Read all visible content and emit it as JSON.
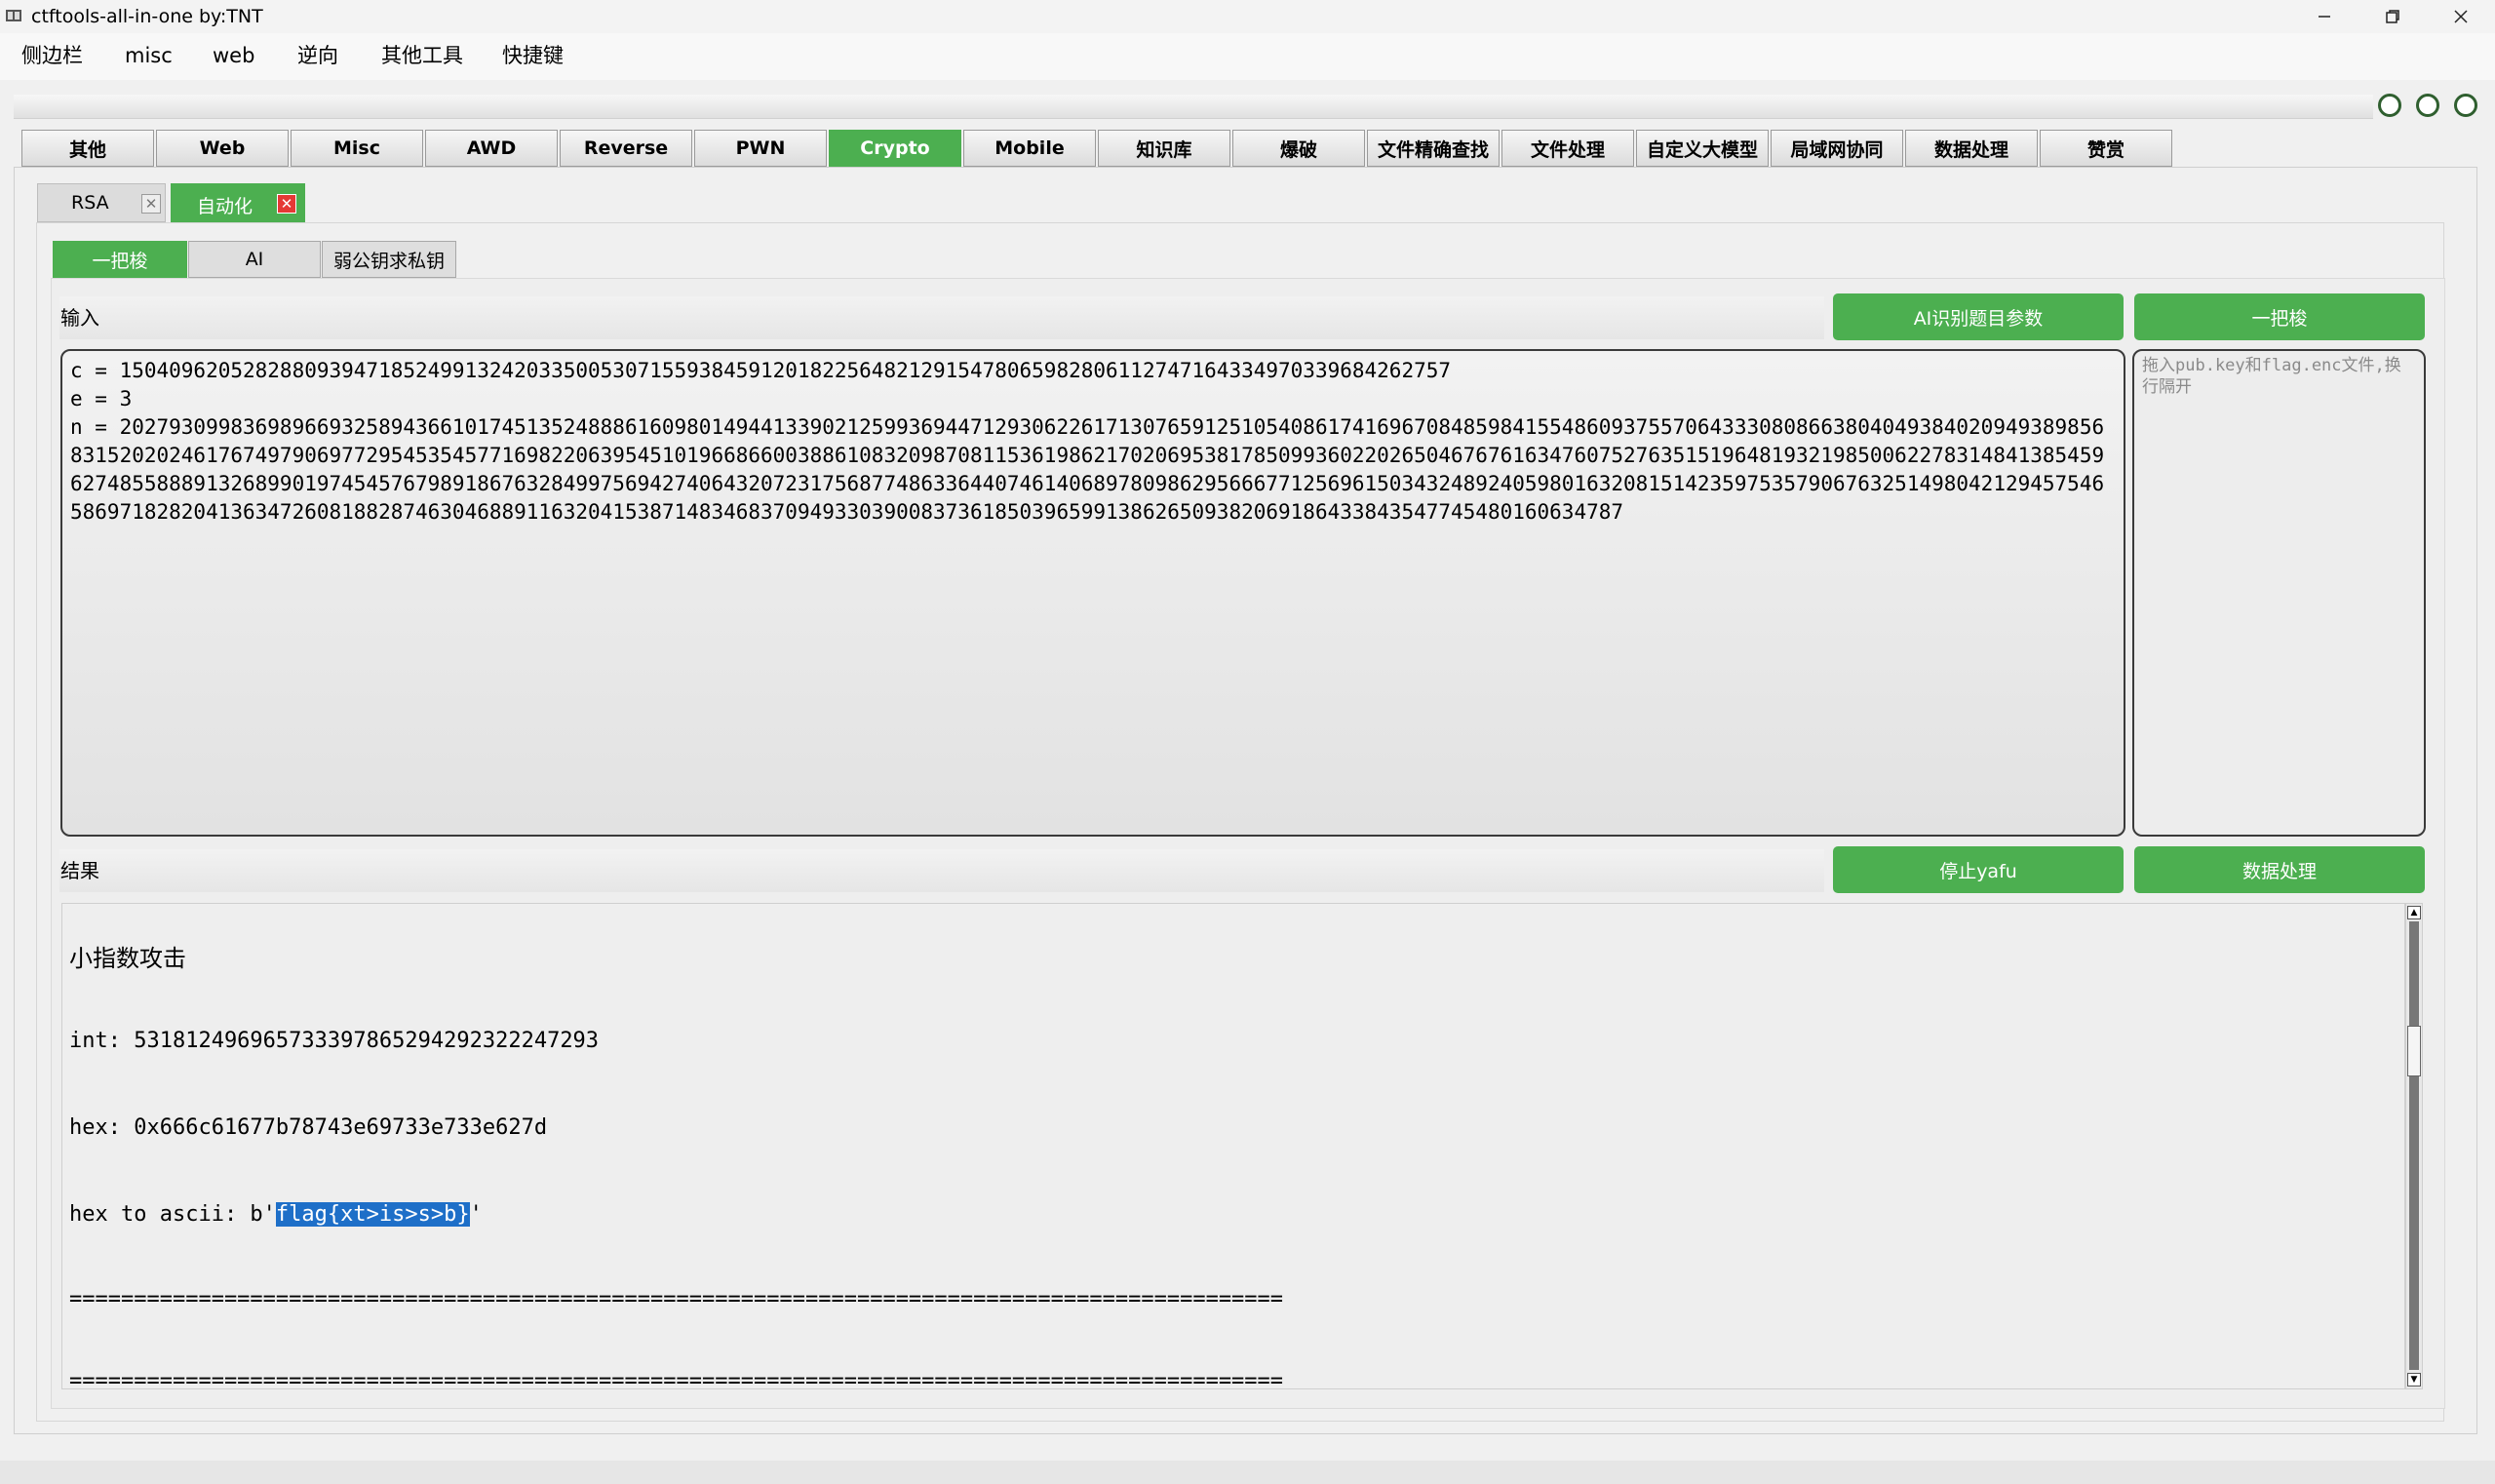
{
  "window": {
    "title": "ctftools-all-in-one   by:TNT"
  },
  "menu": [
    "侧边栏",
    "misc",
    "web",
    "逆向",
    "其他工具",
    "快捷键"
  ],
  "main_tabs": [
    {
      "label": "其他",
      "active": false
    },
    {
      "label": "Web",
      "active": false
    },
    {
      "label": "Misc",
      "active": false
    },
    {
      "label": "AWD",
      "active": false
    },
    {
      "label": "Reverse",
      "active": false
    },
    {
      "label": "PWN",
      "active": false
    },
    {
      "label": "Crypto",
      "active": true
    },
    {
      "label": "Mobile",
      "active": false
    },
    {
      "label": "知识库",
      "active": false
    },
    {
      "label": "爆破",
      "active": false
    },
    {
      "label": "文件精确查找",
      "active": false
    },
    {
      "label": "文件处理",
      "active": false
    },
    {
      "label": "自定义大模型",
      "active": false
    },
    {
      "label": "局域网协同",
      "active": false
    },
    {
      "label": "数据处理",
      "active": false
    },
    {
      "label": "赞赏",
      "active": false
    }
  ],
  "open_tabs": [
    {
      "label": "RSA",
      "active": false
    },
    {
      "label": "自动化",
      "active": true
    }
  ],
  "sub_tabs": [
    {
      "label": "一把梭",
      "active": true
    },
    {
      "label": "AI",
      "active": false
    },
    {
      "label": "弱公钥求私钥",
      "active": false
    }
  ],
  "input_section": {
    "label": "输入",
    "ai_button": "AI识别题目参数",
    "run_button": "一把梭",
    "text": "c = 15040962052828809394718524991324203350053071559384591201822564821291547806598280611274716433497033968426275​7\ne = 3\nn = 20279309983698966932589436610174513524888616098014944133902125993694471293062261713076591251054086174169670848598415548609375570643330808663804049384020949389856831520202461767497906977295453545771698220639545101966866003886108320987081153619862170206953817850993602202650467676163476075276351519648193219850062278314841385459627485588891326899019745457679891867632849975694274064320723175687748633644074614068978098629566677125696150343248924059801632081514235975357906763251498042129457546586971828204136347260818828746304688911632041538714834683709493303900837361850396599138626509382069186433843547745480160634787",
    "side_placeholder": "拖入pub.key和flag.enc文件,换行隔开"
  },
  "result_section": {
    "label": "结果",
    "stop_button": "停止yafu",
    "process_button": "数据处理",
    "heading": "小指数攻击",
    "int_line": "int: 53181249696573339786529429232224729​3",
    "hex_line": "hex: 0x666c61677b78743e69733e733e627d",
    "ascii_prefix": "hex to ascii: b'",
    "ascii_flag": "flag{xt>is>s>b}",
    "ascii_suffix": "'",
    "separator_1": "==============================================================================================",
    "separator_2": "=============================================================================================="
  }
}
